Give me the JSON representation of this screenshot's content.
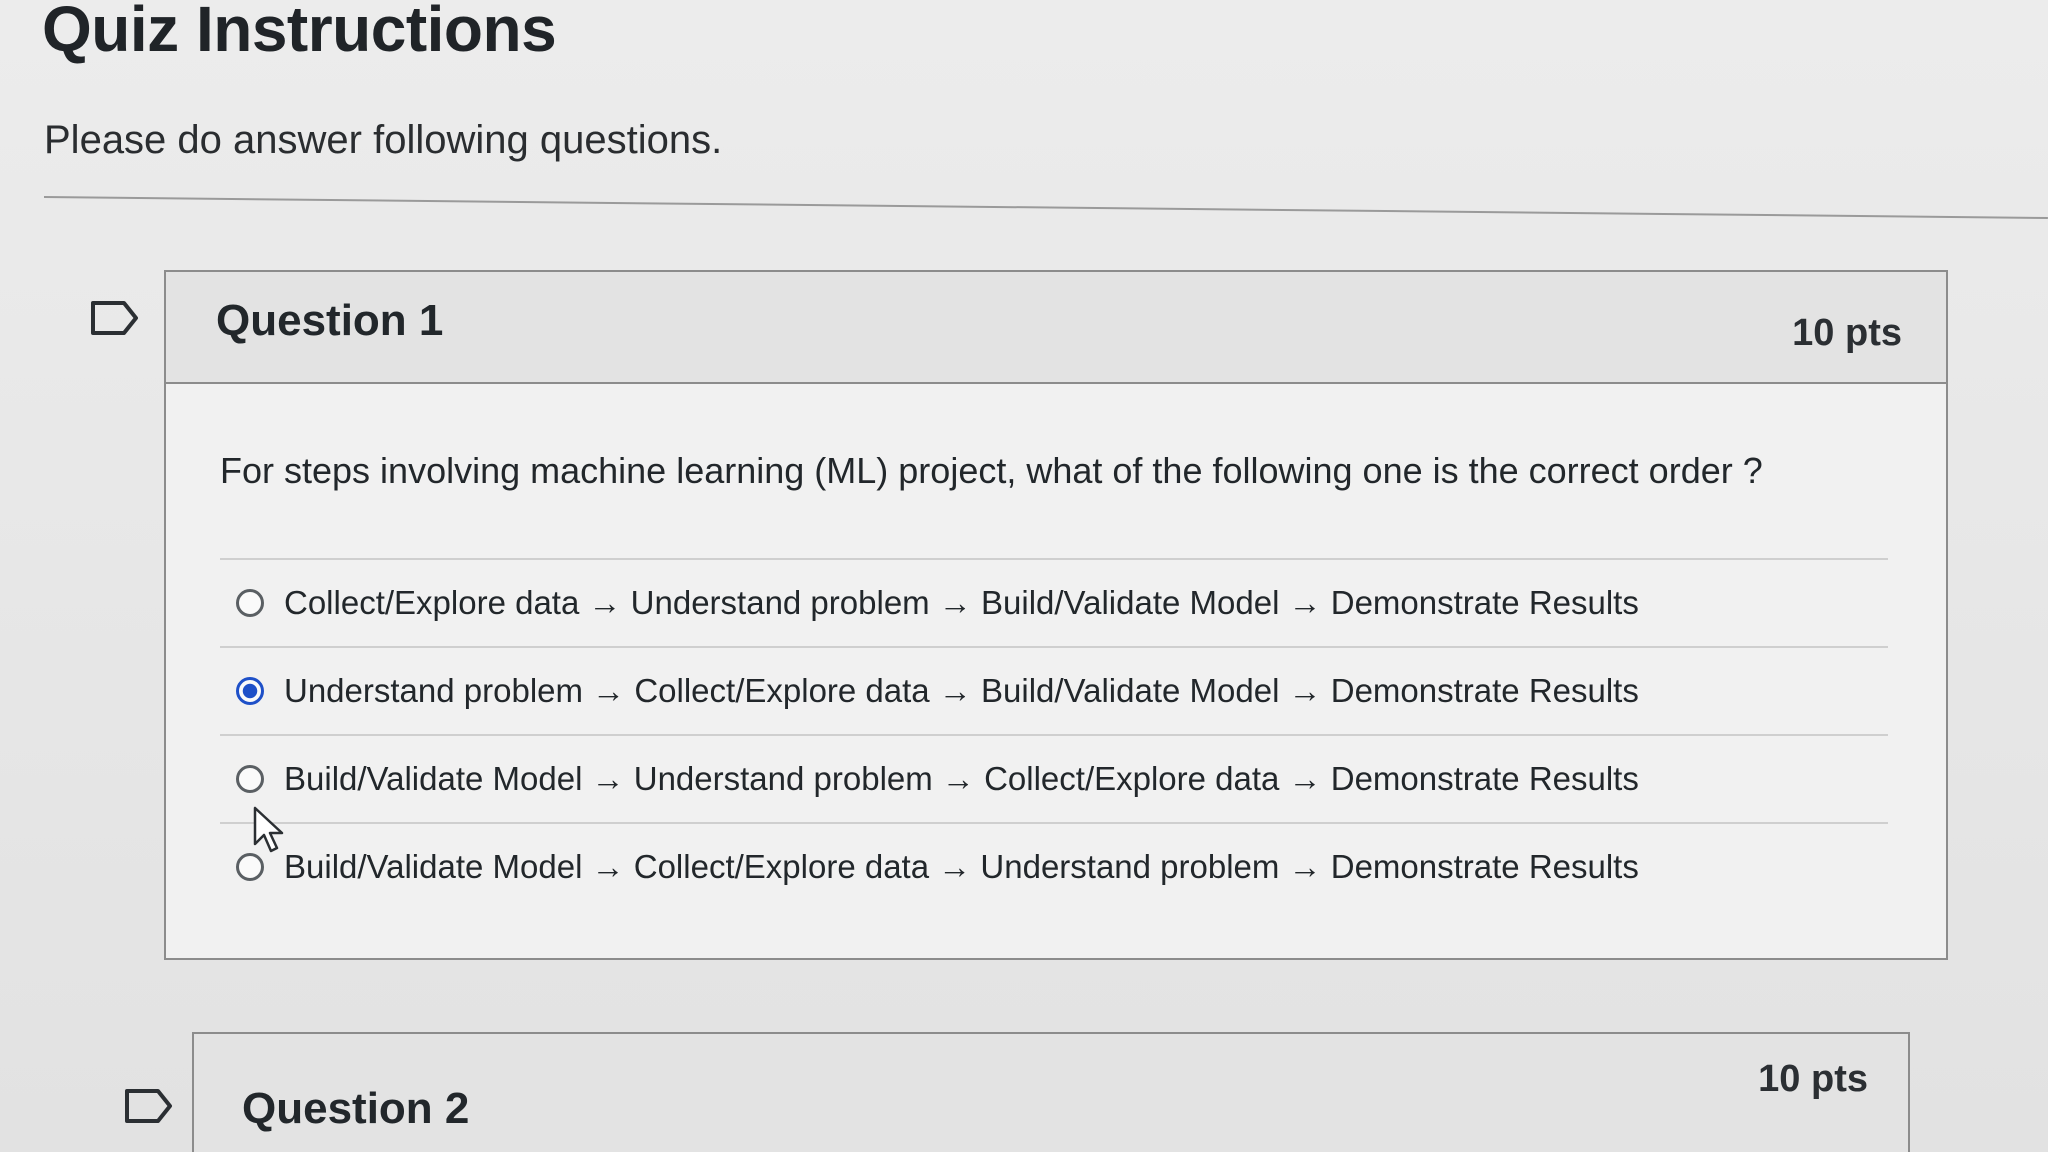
{
  "quiz": {
    "title": "Quiz Instructions",
    "description": "Please do answer following questions."
  },
  "questions": [
    {
      "title": "Question 1",
      "points": "10 pts",
      "text": "For steps involving machine learning (ML) project, what of the following one is the correct order ?",
      "answers": [
        "Collect/Explore data → Understand problem → Build/Validate Model → Demonstrate Results",
        "Understand problem → Collect/Explore data → Build/Validate Model → Demonstrate Results",
        "Build/Validate Model → Understand problem → Collect/Explore data → Demonstrate Results",
        "Build/Validate Model → Collect/Explore data → Understand problem → Demonstrate Results"
      ],
      "selected_index": 1
    },
    {
      "title": "Question 2",
      "points": "10 pts"
    }
  ],
  "colors": {
    "selected_radio": "#1e50c8",
    "border": "#8c8c8c"
  },
  "icons": {
    "flag": "flag-icon",
    "cursor": "mouse-pointer-icon"
  }
}
